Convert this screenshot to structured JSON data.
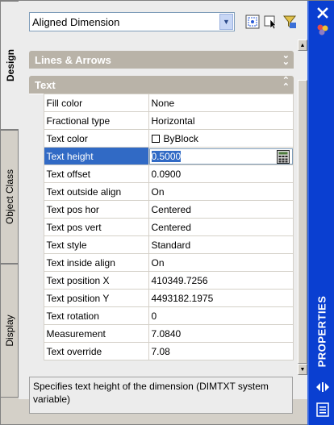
{
  "tabs": [
    {
      "label": "Design",
      "active": true
    },
    {
      "label": "Object Class",
      "active": false
    },
    {
      "label": "Display",
      "active": false
    }
  ],
  "toolbar": {
    "object_type": "Aligned Dimension",
    "buttons": [
      "quick-select-icon",
      "select-objects-icon",
      "toggle-pickadd-icon"
    ]
  },
  "sections": {
    "lines_arrows": "Lines & Arrows",
    "text": "Text"
  },
  "properties": [
    {
      "name": "Fill color",
      "value": "None"
    },
    {
      "name": "Fractional type",
      "value": "Horizontal"
    },
    {
      "name": "Text color",
      "value": "ByBlock",
      "checkbox": true
    },
    {
      "name": "Text height",
      "value": "0.5000",
      "selected": true
    },
    {
      "name": "Text offset",
      "value": "0.0900"
    },
    {
      "name": "Text outside align",
      "value": "On"
    },
    {
      "name": "Text pos hor",
      "value": "Centered"
    },
    {
      "name": "Text pos vert",
      "value": "Centered"
    },
    {
      "name": "Text style",
      "value": "Standard"
    },
    {
      "name": "Text inside align",
      "value": "On"
    },
    {
      "name": "Text position X",
      "value": "410349.7256"
    },
    {
      "name": "Text position Y",
      "value": "4493182.1975"
    },
    {
      "name": "Text rotation",
      "value": "0"
    },
    {
      "name": "Measurement",
      "value": "7.0840"
    },
    {
      "name": "Text override",
      "value": "7.08"
    }
  ],
  "description": "Specifies text height of the dimension (DIMTXT system variable)",
  "palette_title": "PROPERTIES",
  "colors": {
    "title_bar": "#0a3fd1",
    "selection": "#316ac5",
    "section_header": "#b9b3a8"
  }
}
